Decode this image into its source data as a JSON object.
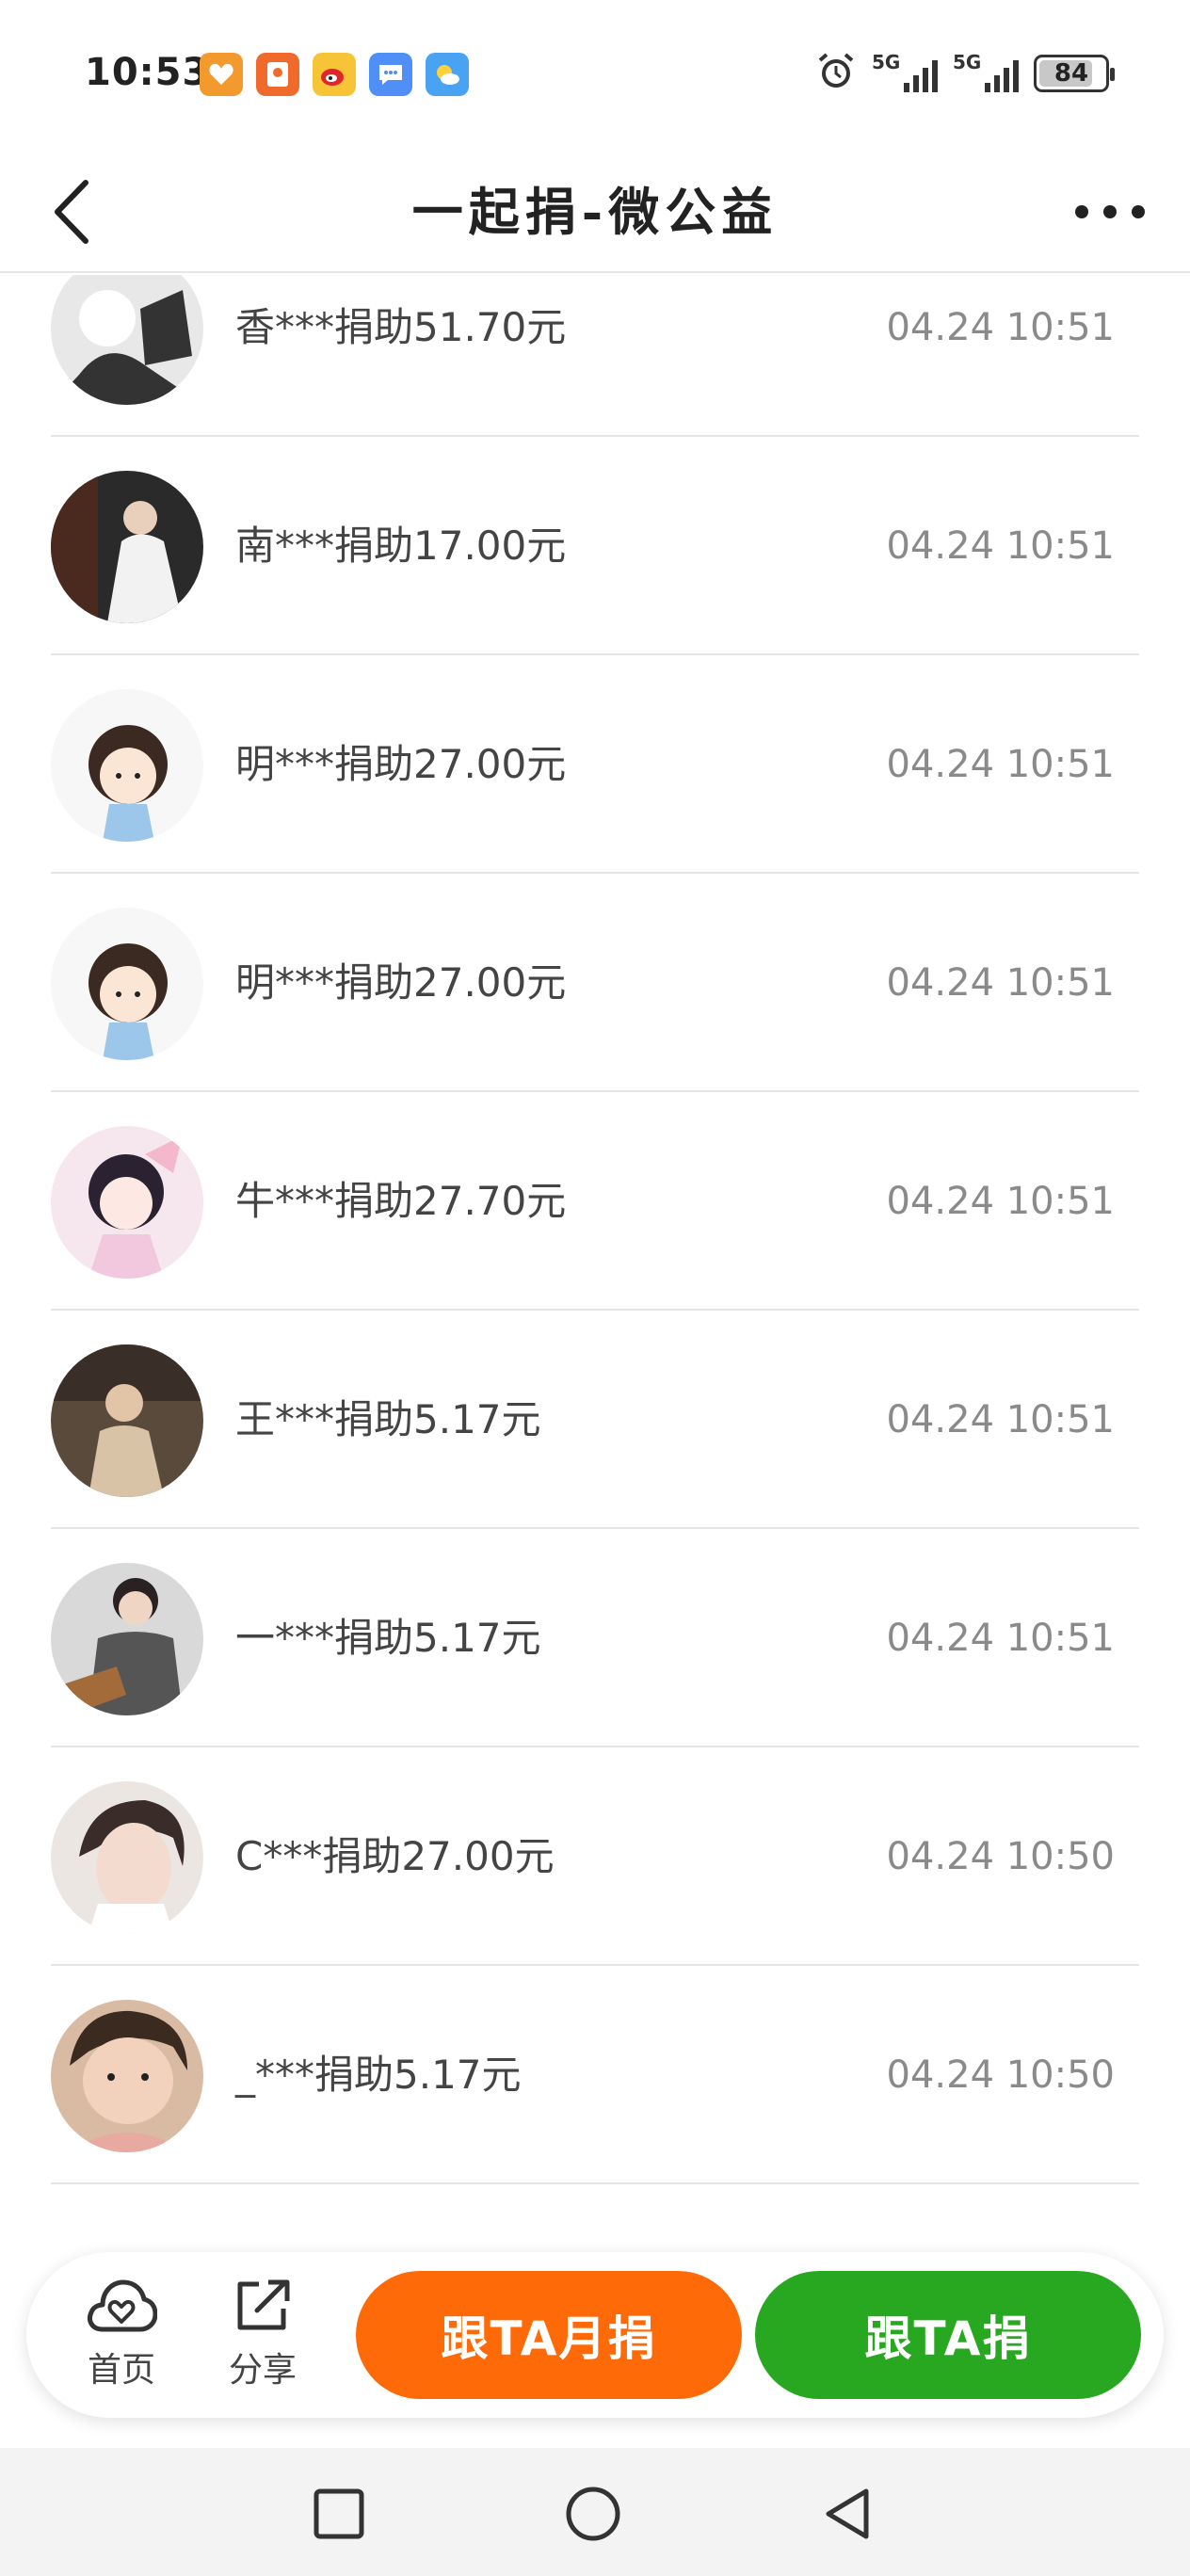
{
  "status_bar": {
    "time": "10:53",
    "app_icons": [
      {
        "name": "heart-app-icon",
        "bg": "#f39a2e"
      },
      {
        "name": "red-packet-app-icon",
        "bg": "#f06b2b"
      },
      {
        "name": "weibo-app-icon",
        "bg": "#f7c437"
      },
      {
        "name": "message-app-icon",
        "bg": "#4f8ff7"
      },
      {
        "name": "weather-app-icon",
        "bg": "#4aa3f2"
      }
    ],
    "network_1": "5G",
    "network_2": "5G",
    "battery": "84"
  },
  "header": {
    "title": "一起捐-微公益"
  },
  "donations": [
    {
      "text": "香***捐助51.70元",
      "time": "04.24 10:51",
      "avatar_bg": "#e8e8e8",
      "avatar_fg": "#333333"
    },
    {
      "text": "南***捐助17.00元",
      "time": "04.24 10:51",
      "avatar_bg": "#2a2a2a",
      "avatar_fg": "#f2f2f2"
    },
    {
      "text": "明***捐助27.00元",
      "time": "04.24 10:51",
      "avatar_bg": "#f7f7f7",
      "avatar_fg": "#3b2a22"
    },
    {
      "text": "明***捐助27.00元",
      "time": "04.24 10:51",
      "avatar_bg": "#f7f7f7",
      "avatar_fg": "#3b2a22"
    },
    {
      "text": "牛***捐助27.70元",
      "time": "04.24 10:51",
      "avatar_bg": "#f6e6ee",
      "avatar_fg": "#2a2230"
    },
    {
      "text": "王***捐助5.17元",
      "time": "04.24 10:51",
      "avatar_bg": "#5a4a3c",
      "avatar_fg": "#d8c3a6"
    },
    {
      "text": "一***捐助5.17元",
      "time": "04.24 10:51",
      "avatar_bg": "#d9d9d9",
      "avatar_fg": "#555555"
    },
    {
      "text": "C***捐助27.00元",
      "time": "04.24 10:50",
      "avatar_bg": "#ece6e2",
      "avatar_fg": "#3a2c28"
    },
    {
      "text": "_***捐助5.17元",
      "time": "04.24 10:50",
      "avatar_bg": "#d9bba3",
      "avatar_fg": "#3a2a20"
    }
  ],
  "bottom_bar": {
    "home_label": "首页",
    "share_label": "分享",
    "monthly_label": "跟TA月捐",
    "donate_label": "跟TA捐"
  },
  "colors": {
    "monthly_button": "#ff6a08",
    "donate_button": "#27a820"
  }
}
